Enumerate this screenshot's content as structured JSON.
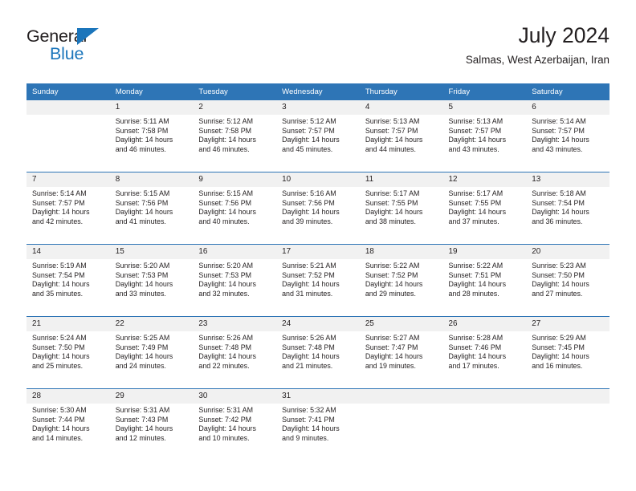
{
  "brand": {
    "name_part1": "General",
    "name_part2": "Blue",
    "accent_color": "#1b75bb"
  },
  "header": {
    "title": "July 2024",
    "subtitle": "Salmas, West Azerbaijan, Iran"
  },
  "calendar": {
    "header_bg": "#2e75b6",
    "daynum_bg": "#f1f1f1",
    "weekday_headers": [
      "Sunday",
      "Monday",
      "Tuesday",
      "Wednesday",
      "Thursday",
      "Friday",
      "Saturday"
    ],
    "weeks": [
      [
        {
          "day": "",
          "sunrise": "",
          "sunset": "",
          "daylight_line1": "",
          "daylight_line2": ""
        },
        {
          "day": "1",
          "sunrise": "Sunrise: 5:11 AM",
          "sunset": "Sunset: 7:58 PM",
          "daylight_line1": "Daylight: 14 hours",
          "daylight_line2": "and 46 minutes."
        },
        {
          "day": "2",
          "sunrise": "Sunrise: 5:12 AM",
          "sunset": "Sunset: 7:58 PM",
          "daylight_line1": "Daylight: 14 hours",
          "daylight_line2": "and 46 minutes."
        },
        {
          "day": "3",
          "sunrise": "Sunrise: 5:12 AM",
          "sunset": "Sunset: 7:57 PM",
          "daylight_line1": "Daylight: 14 hours",
          "daylight_line2": "and 45 minutes."
        },
        {
          "day": "4",
          "sunrise": "Sunrise: 5:13 AM",
          "sunset": "Sunset: 7:57 PM",
          "daylight_line1": "Daylight: 14 hours",
          "daylight_line2": "and 44 minutes."
        },
        {
          "day": "5",
          "sunrise": "Sunrise: 5:13 AM",
          "sunset": "Sunset: 7:57 PM",
          "daylight_line1": "Daylight: 14 hours",
          "daylight_line2": "and 43 minutes."
        },
        {
          "day": "6",
          "sunrise": "Sunrise: 5:14 AM",
          "sunset": "Sunset: 7:57 PM",
          "daylight_line1": "Daylight: 14 hours",
          "daylight_line2": "and 43 minutes."
        }
      ],
      [
        {
          "day": "7",
          "sunrise": "Sunrise: 5:14 AM",
          "sunset": "Sunset: 7:57 PM",
          "daylight_line1": "Daylight: 14 hours",
          "daylight_line2": "and 42 minutes."
        },
        {
          "day": "8",
          "sunrise": "Sunrise: 5:15 AM",
          "sunset": "Sunset: 7:56 PM",
          "daylight_line1": "Daylight: 14 hours",
          "daylight_line2": "and 41 minutes."
        },
        {
          "day": "9",
          "sunrise": "Sunrise: 5:15 AM",
          "sunset": "Sunset: 7:56 PM",
          "daylight_line1": "Daylight: 14 hours",
          "daylight_line2": "and 40 minutes."
        },
        {
          "day": "10",
          "sunrise": "Sunrise: 5:16 AM",
          "sunset": "Sunset: 7:56 PM",
          "daylight_line1": "Daylight: 14 hours",
          "daylight_line2": "and 39 minutes."
        },
        {
          "day": "11",
          "sunrise": "Sunrise: 5:17 AM",
          "sunset": "Sunset: 7:55 PM",
          "daylight_line1": "Daylight: 14 hours",
          "daylight_line2": "and 38 minutes."
        },
        {
          "day": "12",
          "sunrise": "Sunrise: 5:17 AM",
          "sunset": "Sunset: 7:55 PM",
          "daylight_line1": "Daylight: 14 hours",
          "daylight_line2": "and 37 minutes."
        },
        {
          "day": "13",
          "sunrise": "Sunrise: 5:18 AM",
          "sunset": "Sunset: 7:54 PM",
          "daylight_line1": "Daylight: 14 hours",
          "daylight_line2": "and 36 minutes."
        }
      ],
      [
        {
          "day": "14",
          "sunrise": "Sunrise: 5:19 AM",
          "sunset": "Sunset: 7:54 PM",
          "daylight_line1": "Daylight: 14 hours",
          "daylight_line2": "and 35 minutes."
        },
        {
          "day": "15",
          "sunrise": "Sunrise: 5:20 AM",
          "sunset": "Sunset: 7:53 PM",
          "daylight_line1": "Daylight: 14 hours",
          "daylight_line2": "and 33 minutes."
        },
        {
          "day": "16",
          "sunrise": "Sunrise: 5:20 AM",
          "sunset": "Sunset: 7:53 PM",
          "daylight_line1": "Daylight: 14 hours",
          "daylight_line2": "and 32 minutes."
        },
        {
          "day": "17",
          "sunrise": "Sunrise: 5:21 AM",
          "sunset": "Sunset: 7:52 PM",
          "daylight_line1": "Daylight: 14 hours",
          "daylight_line2": "and 31 minutes."
        },
        {
          "day": "18",
          "sunrise": "Sunrise: 5:22 AM",
          "sunset": "Sunset: 7:52 PM",
          "daylight_line1": "Daylight: 14 hours",
          "daylight_line2": "and 29 minutes."
        },
        {
          "day": "19",
          "sunrise": "Sunrise: 5:22 AM",
          "sunset": "Sunset: 7:51 PM",
          "daylight_line1": "Daylight: 14 hours",
          "daylight_line2": "and 28 minutes."
        },
        {
          "day": "20",
          "sunrise": "Sunrise: 5:23 AM",
          "sunset": "Sunset: 7:50 PM",
          "daylight_line1": "Daylight: 14 hours",
          "daylight_line2": "and 27 minutes."
        }
      ],
      [
        {
          "day": "21",
          "sunrise": "Sunrise: 5:24 AM",
          "sunset": "Sunset: 7:50 PM",
          "daylight_line1": "Daylight: 14 hours",
          "daylight_line2": "and 25 minutes."
        },
        {
          "day": "22",
          "sunrise": "Sunrise: 5:25 AM",
          "sunset": "Sunset: 7:49 PM",
          "daylight_line1": "Daylight: 14 hours",
          "daylight_line2": "and 24 minutes."
        },
        {
          "day": "23",
          "sunrise": "Sunrise: 5:26 AM",
          "sunset": "Sunset: 7:48 PM",
          "daylight_line1": "Daylight: 14 hours",
          "daylight_line2": "and 22 minutes."
        },
        {
          "day": "24",
          "sunrise": "Sunrise: 5:26 AM",
          "sunset": "Sunset: 7:48 PM",
          "daylight_line1": "Daylight: 14 hours",
          "daylight_line2": "and 21 minutes."
        },
        {
          "day": "25",
          "sunrise": "Sunrise: 5:27 AM",
          "sunset": "Sunset: 7:47 PM",
          "daylight_line1": "Daylight: 14 hours",
          "daylight_line2": "and 19 minutes."
        },
        {
          "day": "26",
          "sunrise": "Sunrise: 5:28 AM",
          "sunset": "Sunset: 7:46 PM",
          "daylight_line1": "Daylight: 14 hours",
          "daylight_line2": "and 17 minutes."
        },
        {
          "day": "27",
          "sunrise": "Sunrise: 5:29 AM",
          "sunset": "Sunset: 7:45 PM",
          "daylight_line1": "Daylight: 14 hours",
          "daylight_line2": "and 16 minutes."
        }
      ],
      [
        {
          "day": "28",
          "sunrise": "Sunrise: 5:30 AM",
          "sunset": "Sunset: 7:44 PM",
          "daylight_line1": "Daylight: 14 hours",
          "daylight_line2": "and 14 minutes."
        },
        {
          "day": "29",
          "sunrise": "Sunrise: 5:31 AM",
          "sunset": "Sunset: 7:43 PM",
          "daylight_line1": "Daylight: 14 hours",
          "daylight_line2": "and 12 minutes."
        },
        {
          "day": "30",
          "sunrise": "Sunrise: 5:31 AM",
          "sunset": "Sunset: 7:42 PM",
          "daylight_line1": "Daylight: 14 hours",
          "daylight_line2": "and 10 minutes."
        },
        {
          "day": "31",
          "sunrise": "Sunrise: 5:32 AM",
          "sunset": "Sunset: 7:41 PM",
          "daylight_line1": "Daylight: 14 hours",
          "daylight_line2": "and 9 minutes."
        },
        {
          "day": "",
          "sunrise": "",
          "sunset": "",
          "daylight_line1": "",
          "daylight_line2": ""
        },
        {
          "day": "",
          "sunrise": "",
          "sunset": "",
          "daylight_line1": "",
          "daylight_line2": ""
        },
        {
          "day": "",
          "sunrise": "",
          "sunset": "",
          "daylight_line1": "",
          "daylight_line2": ""
        }
      ]
    ]
  }
}
